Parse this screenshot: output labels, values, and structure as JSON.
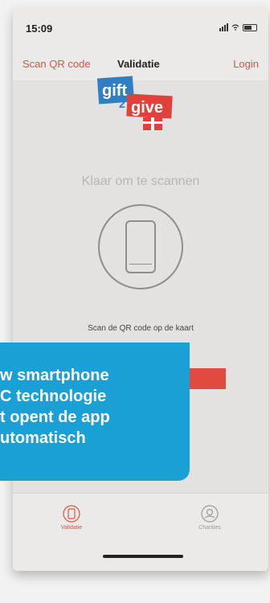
{
  "status_bar": {
    "time": "15:09"
  },
  "nav": {
    "left_label": "Scan QR code",
    "title": "Validatie",
    "right_label": "Login"
  },
  "logo": {
    "line1": "gift",
    "line2": "2",
    "line3": "give"
  },
  "main": {
    "ready_text": "Klaar om te scannen",
    "scan_instruction": "Scan de QR code op de kaart"
  },
  "tabs": [
    {
      "label": "Validatie",
      "icon": "phone-icon"
    },
    {
      "label": "Charities",
      "icon": "charity-icon"
    }
  ],
  "callout": {
    "lines": [
      "w smartphone",
      "C technologie",
      "t opent de app",
      "utomatisch"
    ]
  },
  "colors": {
    "accent": "#e14b3f",
    "callout_bg": "#1aa0d5",
    "logo_red": "#e0413a",
    "logo_blue": "#2f7fc2"
  }
}
